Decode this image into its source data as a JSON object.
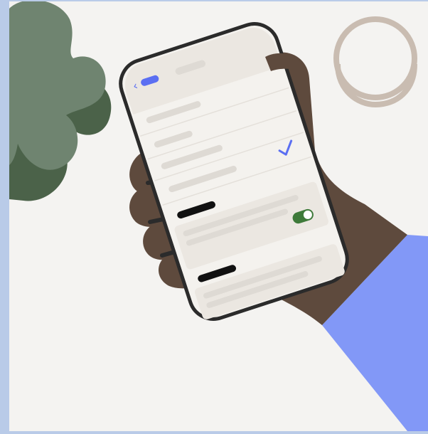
{
  "illustration": {
    "subject": "hand-holding-phone",
    "colors": {
      "background": "#f4f3f1",
      "frame": "#b9cbe8",
      "leaf_light": "#6f8470",
      "leaf_dark": "#4b6249",
      "skin": "#5e4a3d",
      "sleeve": "#8298f7",
      "phone_frame": "#2b2b2b",
      "screen": "#f4f2ee",
      "screen_header": "#ebe7e1",
      "placeholder": "#dedad4",
      "accent_blue": "#5b6ff2",
      "toggle_green": "#3e7a3a",
      "glass": "#c9bcb1"
    },
    "phone": {
      "back_icon": "chevron-left-icon",
      "check_icon": "checkmark-icon",
      "toggle_state": "on"
    }
  }
}
